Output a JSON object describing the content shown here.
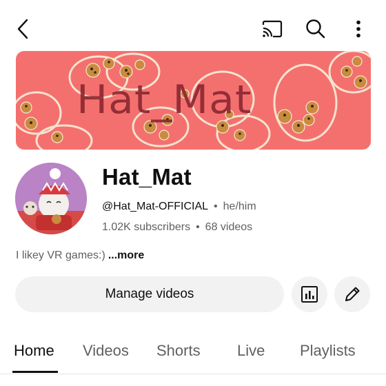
{
  "colors": {
    "banner_bg": "#f4706f",
    "banner_text": "#8a2630",
    "button_bg": "#f2f2f2",
    "secondary_text": "#606060",
    "primary_text": "#0f0f0f"
  },
  "topbar": {
    "icons": [
      "back-arrow-icon",
      "cast-icon",
      "search-icon",
      "more-vertical-icon"
    ]
  },
  "banner": {
    "title": "Hat_Mat"
  },
  "channel": {
    "name": "Hat_Mat",
    "handle": "@Hat_Mat-OFFICIAL",
    "pronouns": "he/him",
    "subscribers": "1.02K subscribers",
    "videos": "68 videos",
    "separator": "•",
    "bio": "I likey VR games:)",
    "more_label": "...more"
  },
  "actions": {
    "manage_label": "Manage videos",
    "analytics_icon": "bar-chart-icon",
    "edit_icon": "pencil-icon"
  },
  "tabs": [
    {
      "label": "Home",
      "active": true
    },
    {
      "label": "Videos",
      "active": false
    },
    {
      "label": "Shorts",
      "active": false
    },
    {
      "label": "Live",
      "active": false
    },
    {
      "label": "Playlists",
      "active": false
    }
  ]
}
